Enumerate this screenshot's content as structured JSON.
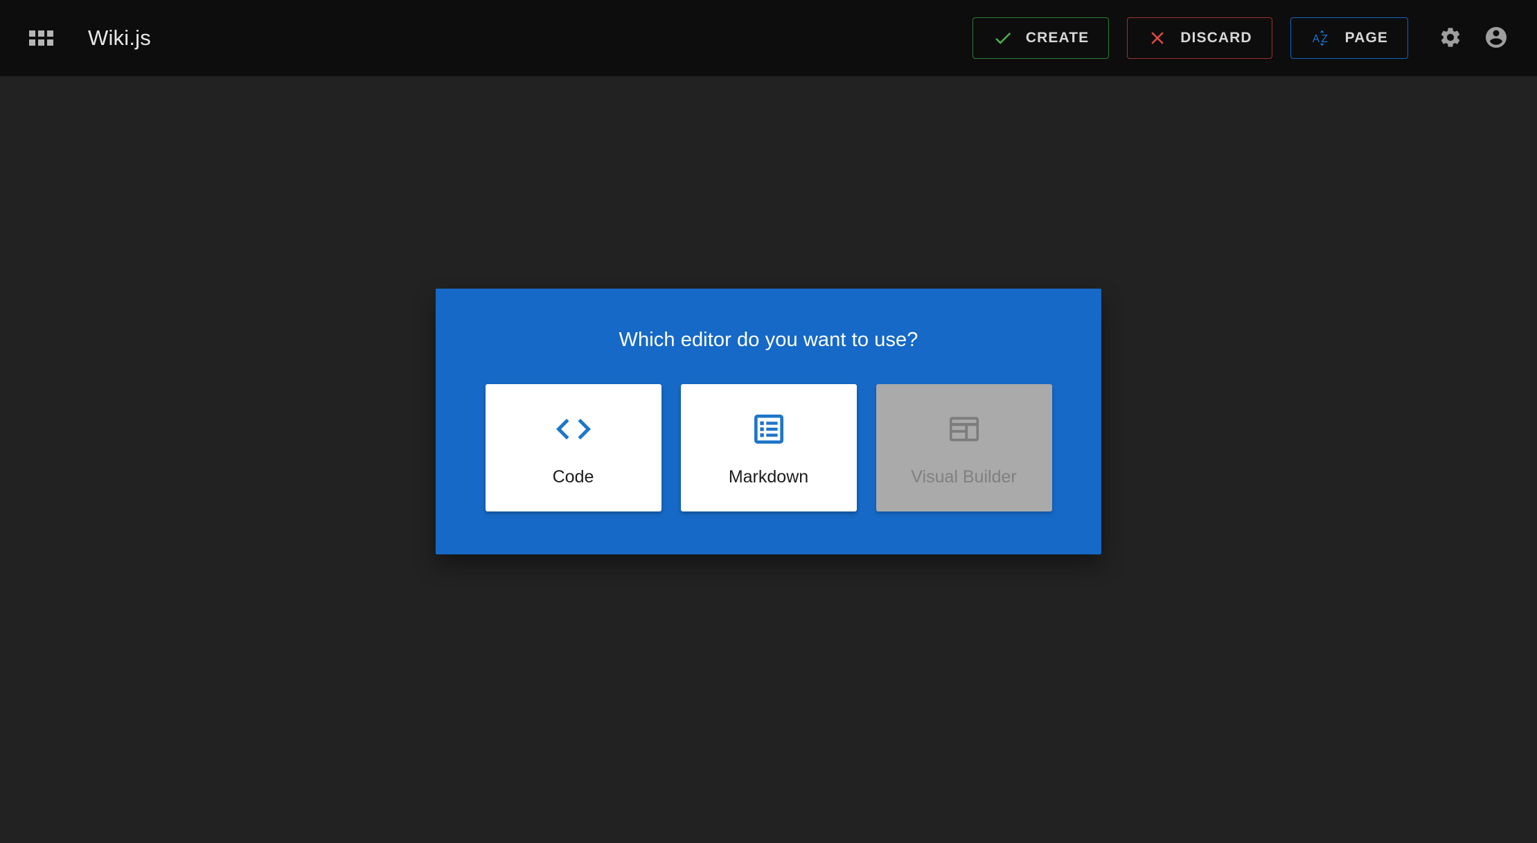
{
  "header": {
    "apps_icon": "apps-grid-icon",
    "brand": "Wiki.js",
    "actions": [
      {
        "id": "create",
        "label": "CREATE",
        "icon": "check-icon",
        "color": "#2f7d32"
      },
      {
        "id": "discard",
        "label": "DISCARD",
        "icon": "close-x-icon",
        "color": "#9a3330"
      },
      {
        "id": "page",
        "label": "PAGE",
        "icon": "sort-alphabetical-icon",
        "color": "#1565c0"
      }
    ],
    "settings_icon": "gear-icon",
    "account_icon": "account-circle-icon"
  },
  "dialog": {
    "title": "Which editor do you want to use?",
    "background": "#1669c6",
    "editors": [
      {
        "id": "code",
        "label": "Code",
        "icon": "code-tags-icon",
        "disabled": false
      },
      {
        "id": "markdown",
        "label": "Markdown",
        "icon": "list-box-icon",
        "disabled": false
      },
      {
        "id": "visualbuilder",
        "label": "Visual Builder",
        "icon": "view-quilt-icon",
        "disabled": true
      }
    ]
  },
  "theme": {
    "header_bg": "#0d0d0d",
    "page_bg": "#222222",
    "accent": "#1669c6",
    "card_bg": "#ffffff",
    "card_disabled_bg": "#aaaaaa"
  }
}
